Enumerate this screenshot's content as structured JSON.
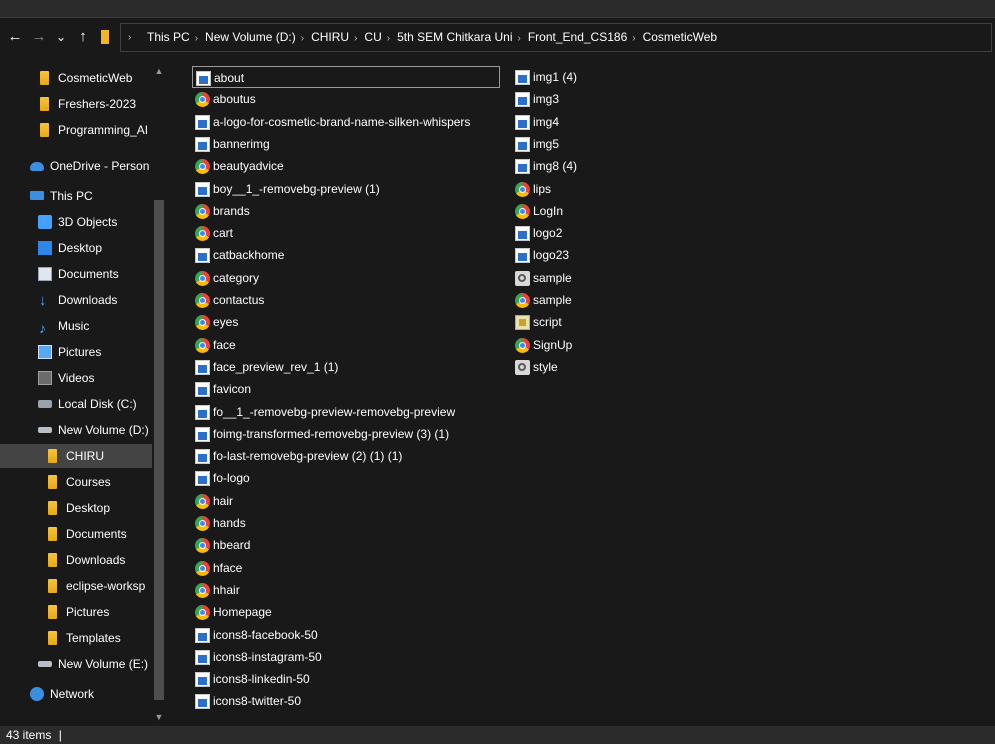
{
  "navigation": {
    "back_glyph": "←",
    "forward_glyph": "→",
    "recent_glyph": "⌄",
    "up_glyph": "↑"
  },
  "address_bar": {
    "breadcrumbs": [
      "This PC",
      "New Volume (D:)",
      "CHIRU",
      "CU",
      "5th SEM Chitkara Uni",
      "Front_End_CS186",
      "CosmeticWeb"
    ],
    "separator": "›"
  },
  "nav_pane": {
    "items": [
      {
        "label": "CosmeticWeb",
        "icon": "folder-icon"
      },
      {
        "label": "Freshers-2023",
        "icon": "folder-icon"
      },
      {
        "label": "Programming_AI",
        "icon": "folder-icon"
      },
      {
        "label": "OneDrive - Person",
        "icon": "cloud-icon"
      },
      {
        "label": "This PC",
        "icon": "pc-icon"
      },
      {
        "label": "3D Objects",
        "icon": "cube-icon"
      },
      {
        "label": "Desktop",
        "icon": "desktop-icon"
      },
      {
        "label": "Documents",
        "icon": "documents-icon"
      },
      {
        "label": "Downloads",
        "icon": "download-icon"
      },
      {
        "label": "Music",
        "icon": "music-icon"
      },
      {
        "label": "Pictures",
        "icon": "pictures-icon"
      },
      {
        "label": "Videos",
        "icon": "videos-icon"
      },
      {
        "label": "Local Disk (C:)",
        "icon": "local-disk-icon"
      },
      {
        "label": "New Volume (D:)",
        "icon": "drive-icon"
      },
      {
        "label": "CHIRU",
        "icon": "folder-icon",
        "selected": true
      },
      {
        "label": "Courses",
        "icon": "folder-icon"
      },
      {
        "label": "Desktop",
        "icon": "folder-icon"
      },
      {
        "label": "Documents",
        "icon": "folder-icon"
      },
      {
        "label": "Downloads",
        "icon": "folder-icon"
      },
      {
        "label": "eclipse-worksp",
        "icon": "folder-icon"
      },
      {
        "label": "Pictures",
        "icon": "folder-icon"
      },
      {
        "label": "Templates",
        "icon": "folder-icon"
      },
      {
        "label": "New Volume (E:)",
        "icon": "drive-icon"
      },
      {
        "label": "Network",
        "icon": "network-icon"
      }
    ]
  },
  "files": {
    "column1": [
      {
        "name": "about",
        "icon": "image-file-icon",
        "focused": true
      },
      {
        "name": "aboutus",
        "icon": "chrome-html-icon"
      },
      {
        "name": "a-logo-for-cosmetic-brand-name-silken-whispers",
        "icon": "image-file-icon"
      },
      {
        "name": "bannerimg",
        "icon": "image-file-icon"
      },
      {
        "name": "beautyadvice",
        "icon": "chrome-html-icon"
      },
      {
        "name": "boy__1_-removebg-preview (1)",
        "icon": "image-file-icon"
      },
      {
        "name": "brands",
        "icon": "chrome-html-icon"
      },
      {
        "name": "cart",
        "icon": "chrome-html-icon"
      },
      {
        "name": "catbackhome",
        "icon": "image-file-icon"
      },
      {
        "name": "category",
        "icon": "chrome-html-icon"
      },
      {
        "name": "contactus",
        "icon": "chrome-html-icon"
      },
      {
        "name": "eyes",
        "icon": "chrome-html-icon"
      },
      {
        "name": "face",
        "icon": "chrome-html-icon"
      },
      {
        "name": "face_preview_rev_1 (1)",
        "icon": "image-file-icon"
      },
      {
        "name": "favicon",
        "icon": "image-file-icon"
      },
      {
        "name": "fo__1_-removebg-preview-removebg-preview",
        "icon": "image-file-icon"
      },
      {
        "name": "foimg-transformed-removebg-preview (3) (1)",
        "icon": "image-file-icon"
      },
      {
        "name": "fo-last-removebg-preview (2) (1) (1)",
        "icon": "image-file-icon"
      },
      {
        "name": "fo-logo",
        "icon": "image-file-icon"
      },
      {
        "name": "hair",
        "icon": "chrome-html-icon"
      },
      {
        "name": "hands",
        "icon": "chrome-html-icon"
      },
      {
        "name": "hbeard",
        "icon": "chrome-html-icon"
      },
      {
        "name": "hface",
        "icon": "chrome-html-icon"
      },
      {
        "name": "hhair",
        "icon": "chrome-html-icon"
      },
      {
        "name": "Homepage",
        "icon": "chrome-html-icon"
      },
      {
        "name": "icons8-facebook-50",
        "icon": "image-file-icon"
      },
      {
        "name": "icons8-instagram-50",
        "icon": "image-file-icon"
      },
      {
        "name": "icons8-linkedin-50",
        "icon": "image-file-icon"
      },
      {
        "name": "icons8-twitter-50",
        "icon": "image-file-icon"
      }
    ],
    "column2": [
      {
        "name": "img1 (4)",
        "icon": "image-file-icon"
      },
      {
        "name": "img3",
        "icon": "image-file-icon"
      },
      {
        "name": "img4",
        "icon": "image-file-icon"
      },
      {
        "name": "img5",
        "icon": "image-file-icon"
      },
      {
        "name": "img8 (4)",
        "icon": "image-file-icon"
      },
      {
        "name": "lips",
        "icon": "chrome-html-icon"
      },
      {
        "name": "LogIn",
        "icon": "chrome-html-icon"
      },
      {
        "name": "logo2",
        "icon": "image-file-icon"
      },
      {
        "name": "logo23",
        "icon": "image-file-icon"
      },
      {
        "name": "sample",
        "icon": "css-file-icon"
      },
      {
        "name": "sample",
        "icon": "chrome-html-icon"
      },
      {
        "name": "script",
        "icon": "js-file-icon"
      },
      {
        "name": "SignUp",
        "icon": "chrome-html-icon"
      },
      {
        "name": "style",
        "icon": "css-file-icon"
      }
    ]
  },
  "status_bar": {
    "item_count": "43 items",
    "separator": "|"
  },
  "colors": {
    "background": "#191919",
    "selected_row": "#444444",
    "folder": "#f2b626",
    "chrome_blue": "#4285f4"
  }
}
